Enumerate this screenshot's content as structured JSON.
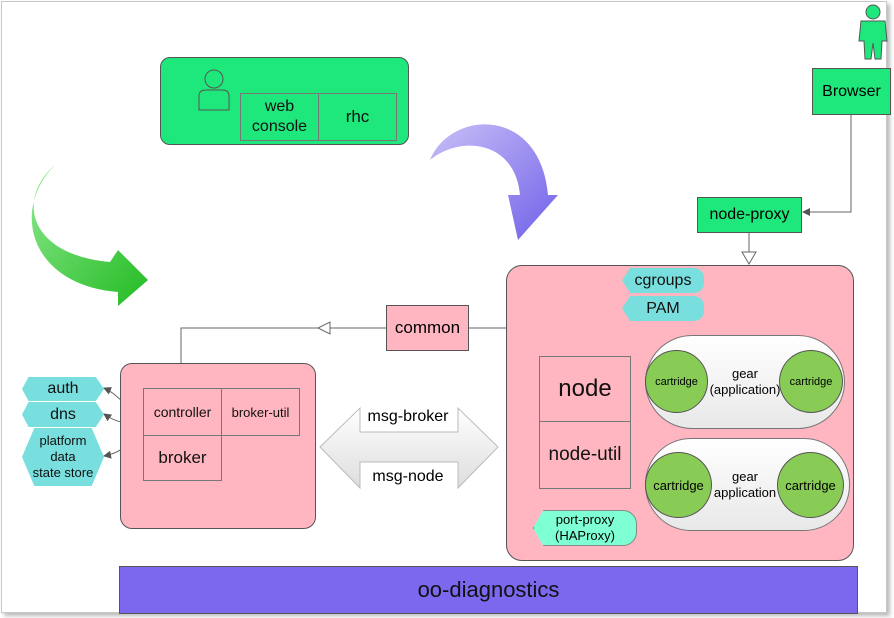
{
  "client": {
    "web_console": "web\nconsole",
    "rhc": "rhc"
  },
  "browser": {
    "label": "Browser"
  },
  "node_proxy": {
    "label": "node-proxy"
  },
  "common": {
    "label": "common"
  },
  "broker_host": {
    "controller": "controller",
    "broker_util": "broker-util",
    "broker": "broker"
  },
  "services": {
    "auth": "auth",
    "dns": "dns",
    "datastore": "platform\ndata\nstate store"
  },
  "messaging": {
    "broker": "msg-broker",
    "node": "msg-node"
  },
  "node_host": {
    "cgroups": "cgroups",
    "pam": "PAM",
    "node": "node",
    "node_util": "node-util",
    "port_proxy": "port-proxy\n(HAProxy)",
    "gears": [
      {
        "label": "gear\n(application)",
        "cartridges": [
          "cartridge",
          "cartridge"
        ]
      },
      {
        "label": "gear\napplication",
        "cartridges": [
          "cartridge",
          "cartridge"
        ]
      }
    ]
  },
  "diagnostics": {
    "label": "oo-diagnostics"
  },
  "colors": {
    "green": "#1ee87c",
    "pink": "#ffb6c1",
    "teal": "#79dede",
    "purple": "#7b68ee",
    "cartridge": "#88cc55"
  }
}
